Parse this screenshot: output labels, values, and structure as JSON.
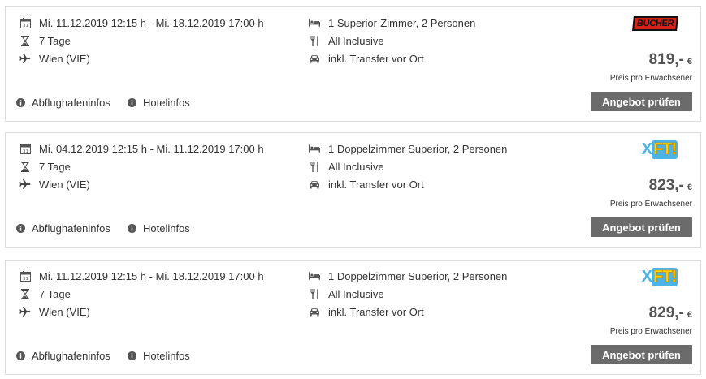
{
  "offers": [
    {
      "dates": "Mi. 11.12.2019 12:15 h - Mi. 18.12.2019 17:00 h",
      "duration": "7 Tage",
      "airport": "Wien (VIE)",
      "room": "1 Superior-Zimmer, 2 Personen",
      "board": "All Inclusive",
      "transfer": "inkl. Transfer vor Ort",
      "operator_logo_text": "BUCHER",
      "price": "819,-",
      "currency": "€",
      "price_note": "Preis pro Erwachsener",
      "airport_info_label": "Abflughafeninfos",
      "hotel_info_label": "Hotelinfos",
      "button_label": "Angebot prüfen"
    },
    {
      "dates": "Mi. 04.12.2019 12:15 h - Mi. 11.12.2019 17:00 h",
      "duration": "7 Tage",
      "airport": "Wien (VIE)",
      "room": "1 Doppelzimmer Superior, 2 Personen",
      "board": "All Inclusive",
      "transfer": "inkl. Transfer vor Ort",
      "operator_logo_text": "XFT!",
      "price": "823,-",
      "currency": "€",
      "price_note": "Preis pro Erwachsener",
      "airport_info_label": "Abflughafeninfos",
      "hotel_info_label": "Hotelinfos",
      "button_label": "Angebot prüfen"
    },
    {
      "dates": "Mi. 11.12.2019 12:15 h - Mi. 18.12.2019 17:00 h",
      "duration": "7 Tage",
      "airport": "Wien (VIE)",
      "room": "1 Doppelzimmer Superior, 2 Personen",
      "board": "All Inclusive",
      "transfer": "inkl. Transfer vor Ort",
      "operator_logo_text": "XFT!",
      "price": "829,-",
      "currency": "€",
      "price_note": "Preis pro Erwachsener",
      "airport_info_label": "Abflughafeninfos",
      "hotel_info_label": "Hotelinfos",
      "button_label": "Angebot prüfen"
    }
  ],
  "icons": {
    "calendar": "calendar-icon",
    "duration": "hourglass-icon",
    "flight": "airplane-icon",
    "room": "bed-icon",
    "board": "cutlery-icon",
    "transfer": "car-icon",
    "info": "info-icon"
  },
  "colors": {
    "button_bg": "#6b6b6b",
    "bucher_red": "#d9201b",
    "xft_blue": "#4bb3e6",
    "xft_yellow": "#ffd200"
  }
}
